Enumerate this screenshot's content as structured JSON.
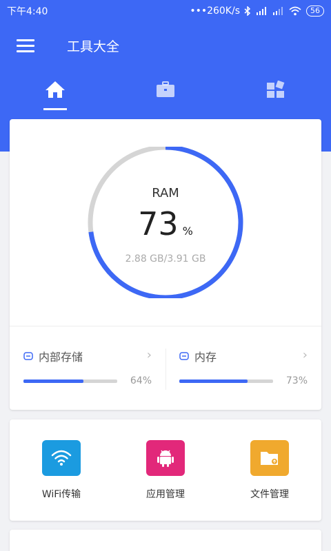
{
  "status": {
    "time": "下午4:40",
    "speed": "•••260K/s",
    "battery": "56"
  },
  "app": {
    "title": "工具大全"
  },
  "tabs": [
    {
      "name": "home",
      "icon": "home-icon"
    },
    {
      "name": "toolbox",
      "icon": "toolbox-icon"
    },
    {
      "name": "apps",
      "icon": "apps-icon"
    }
  ],
  "ram": {
    "label": "RAM",
    "percent_value": "73",
    "percent_unit": "%",
    "detail": "2.88 GB/3.91 GB",
    "fraction": 0.73
  },
  "storage": [
    {
      "label": "内部存储",
      "percent": "64%",
      "fraction": 0.64
    },
    {
      "label": "内存",
      "percent": "73%",
      "fraction": 0.73
    }
  ],
  "tools": [
    {
      "label": "WiFi传输",
      "color": "#1b9be0",
      "icon": "wifi-icon"
    },
    {
      "label": "应用管理",
      "color": "#e2287a",
      "icon": "android-icon"
    },
    {
      "label": "文件管理",
      "color": "#f0a92e",
      "icon": "folder-icon"
    }
  ],
  "colors": {
    "primary": "#3d68f5",
    "track": "#d5d5d5"
  }
}
